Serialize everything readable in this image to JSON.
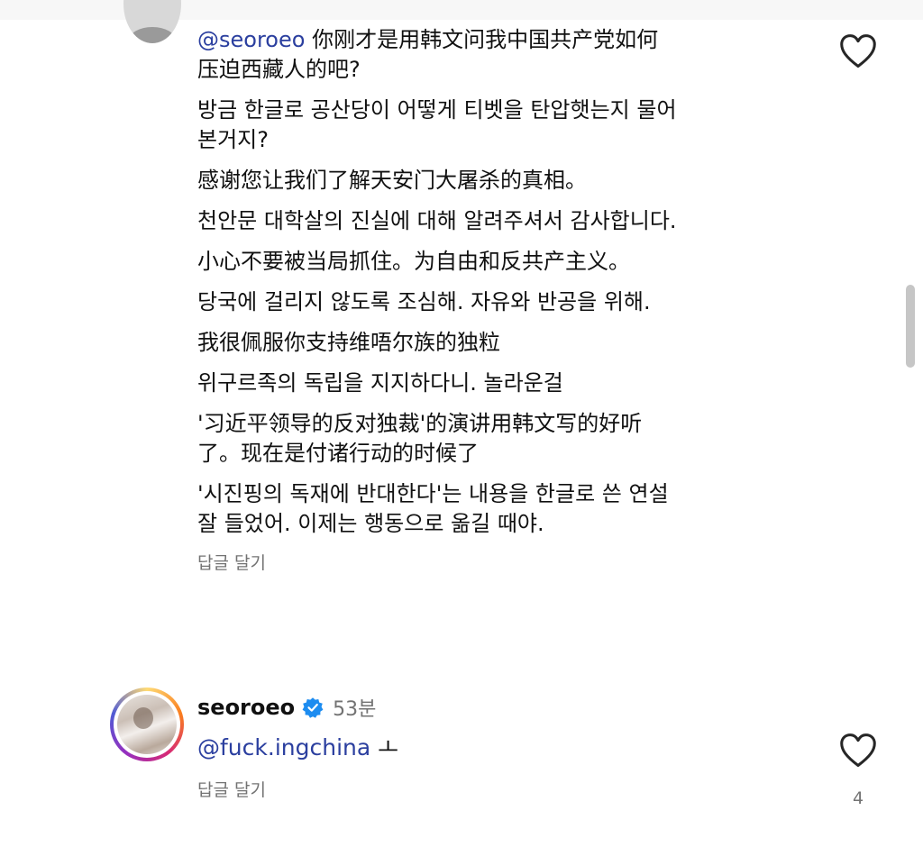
{
  "comment1": {
    "lines": [
      {
        "mention": "@seoroeo",
        "text": " 你刚才是用韩文问我中国共产党如何\n压迫西藏人的吧?"
      },
      {
        "mention": "",
        "text": "방금 한글로 공산당이 어떻게 티벳을 탄압햇는지 물어\n본거지?"
      },
      {
        "mention": "",
        "text": "感谢您让我们了解天安门大屠杀的真相。"
      },
      {
        "mention": "",
        "text": "천안문 대학살의 진실에 대해 알려주셔서 감사합니다."
      },
      {
        "mention": "",
        "text": "小心不要被当局抓住。为自由和反共产主义。"
      },
      {
        "mention": "",
        "text": "당국에 걸리지 않도록 조심해. 자유와 반공을 위해."
      },
      {
        "mention": "",
        "text": "我很佩服你支持维唔尔族的独粒"
      },
      {
        "mention": "",
        "text": "위구르족의 독립을 지지하다니. 놀라운걸"
      },
      {
        "mention": "",
        "text": "'习近平领导的反对独裁'的演讲用韩文写的好听\n了。现在是付诸行动的时候了"
      },
      {
        "mention": "",
        "text": "'시진핑의 독재에 반대한다'는 내용을 한글로 쓴 연설\n잘 들었어. 이제는 행동으로 옮길 때야."
      }
    ],
    "reply_label": "답글 달기",
    "heart_icon": "heart-outline-icon"
  },
  "comment2": {
    "username": "seoroeo",
    "verified_icon": "verified-badge-icon",
    "time": "53분",
    "mention": "@fuck.ingchina",
    "text": " ㅗ",
    "reply_label": "답글 달기",
    "like_count": "4",
    "heart_icon": "heart-outline-icon"
  },
  "colors": {
    "mention": "#2b3f9f",
    "secondary_text": "#737373",
    "verified": "#1d8cf0"
  }
}
